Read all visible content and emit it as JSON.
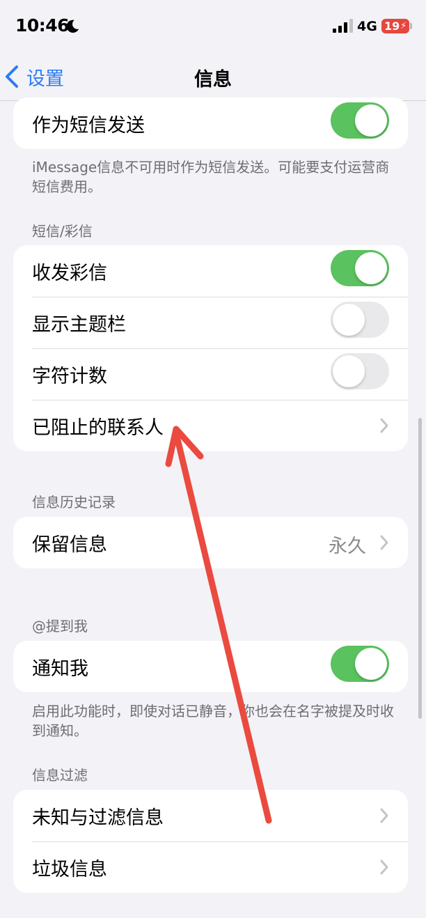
{
  "status_bar": {
    "time": "10:46",
    "network": "4G",
    "battery": "19",
    "icons": [
      "moon-icon",
      "signal-icon",
      "charging-icon"
    ]
  },
  "nav": {
    "back_label": "设置",
    "title": "信息"
  },
  "groups": {
    "send_sms": {
      "rows": [
        {
          "label": "作为短信发送",
          "toggle": true
        }
      ],
      "footer": "iMessage信息不可用时作为短信发送。可能要支付运营商短信费用。"
    },
    "sms_mms": {
      "header": "短信/彩信",
      "rows": [
        {
          "label": "收发彩信",
          "toggle": true
        },
        {
          "label": "显示主题栏",
          "toggle": false
        },
        {
          "label": "字符计数",
          "toggle": false
        },
        {
          "label": "已阻止的联系人",
          "chevron": true
        }
      ]
    },
    "history": {
      "header": "信息历史记录",
      "rows": [
        {
          "label": "保留信息",
          "value": "永久",
          "chevron": true
        }
      ]
    },
    "mentions": {
      "header": "@提到我",
      "rows": [
        {
          "label": "通知我",
          "toggle": true
        }
      ],
      "footer": "启用此功能时，即使对话已静音，你也会在名字被提及时收到通知。"
    },
    "filtering": {
      "header": "信息过滤",
      "rows": [
        {
          "label": "未知与过滤信息",
          "chevron": true
        },
        {
          "label": "垃圾信息",
          "chevron": true
        }
      ]
    }
  },
  "colors": {
    "accent_blue": "#2a7cf6",
    "toggle_on": "#5ac25e",
    "toggle_off": "#e9e9eb",
    "annotation_arrow": "#ea4a3f",
    "battery_low": "#e5473e"
  }
}
